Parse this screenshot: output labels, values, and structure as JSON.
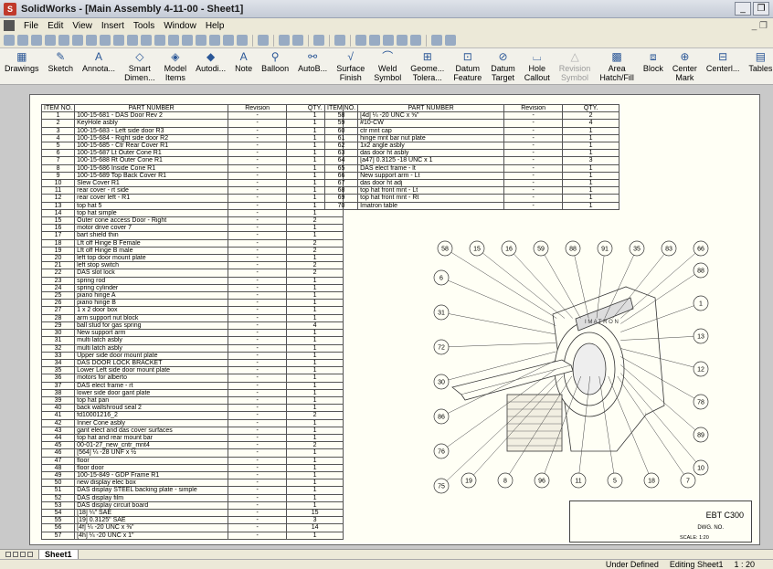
{
  "window": {
    "title": "SolidWorks - [Main Assembly 4-11-00 - Sheet1]"
  },
  "menu": [
    "File",
    "Edit",
    "View",
    "Insert",
    "Tools",
    "Window",
    "Help"
  ],
  "command_manager": [
    {
      "label": "Drawings",
      "icon": "drawings-icon",
      "glyph": "▦",
      "enabled": true
    },
    {
      "label": "Sketch",
      "icon": "sketch-icon",
      "glyph": "✎",
      "enabled": true
    },
    {
      "label": "Annota...",
      "icon": "annotation-icon",
      "glyph": "A",
      "enabled": true
    },
    {
      "label": "Smart Dimen...",
      "icon": "smart-dimension-icon",
      "glyph": "◇",
      "enabled": true
    },
    {
      "label": "Model Items",
      "icon": "model-items-icon",
      "glyph": "◈",
      "enabled": true
    },
    {
      "label": "Autodi...",
      "icon": "autodimension-icon",
      "glyph": "◆",
      "enabled": true
    },
    {
      "label": "Note",
      "icon": "note-icon",
      "glyph": "A",
      "enabled": true
    },
    {
      "label": "Balloon",
      "icon": "balloon-icon",
      "glyph": "⚲",
      "enabled": true
    },
    {
      "label": "AutoB...",
      "icon": "auto-balloon-icon",
      "glyph": "⚯",
      "enabled": true
    },
    {
      "label": "Surface Finish",
      "icon": "surface-finish-icon",
      "glyph": "√",
      "enabled": true
    },
    {
      "label": "Weld Symbol",
      "icon": "weld-symbol-icon",
      "glyph": "⌒",
      "enabled": true
    },
    {
      "label": "Geome... Tolera...",
      "icon": "geometric-tolerance-icon",
      "glyph": "⊞",
      "enabled": true
    },
    {
      "label": "Datum Feature",
      "icon": "datum-feature-icon",
      "glyph": "⊡",
      "enabled": true
    },
    {
      "label": "Datum Target",
      "icon": "datum-target-icon",
      "glyph": "⊘",
      "enabled": true
    },
    {
      "label": "Hole Callout",
      "icon": "hole-callout-icon",
      "glyph": "⌴",
      "enabled": true
    },
    {
      "label": "Revision Symbol",
      "icon": "revision-symbol-icon",
      "glyph": "△",
      "enabled": false
    },
    {
      "label": "Area Hatch/Fill",
      "icon": "area-hatch-icon",
      "glyph": "▩",
      "enabled": true
    },
    {
      "label": "Block",
      "icon": "block-icon",
      "glyph": "⧈",
      "enabled": true
    },
    {
      "label": "Center Mark",
      "icon": "center-mark-icon",
      "glyph": "⊕",
      "enabled": true
    },
    {
      "label": "Centerl...",
      "icon": "centerline-icon",
      "glyph": "⊟",
      "enabled": true
    },
    {
      "label": "Tables",
      "icon": "tables-icon",
      "glyph": "▤",
      "enabled": true
    }
  ],
  "bom_headers": [
    "ITEM NO.",
    "PART NUMBER",
    "Revision",
    "QTY."
  ],
  "bom_left": [
    [
      "1",
      "100-15-681 - DAS Door Rev 2",
      "-",
      "1"
    ],
    [
      "2",
      "KeyHole asbly",
      "-",
      "1"
    ],
    [
      "3",
      "100-15-683 - Left side door R3",
      "-",
      "1"
    ],
    [
      "4",
      "100-15-684 - Right side door R2",
      "-",
      "1"
    ],
    [
      "5",
      "100-15-685 - Ctr Rear Cover R1",
      "-",
      "1"
    ],
    [
      "6",
      "100-15-687 Lt Outer Cone R1",
      "-",
      "1"
    ],
    [
      "7",
      "100-15-688 Rt Outer Cone R1",
      "-",
      "1"
    ],
    [
      "8",
      "100-15-686 Inside Cone R1",
      "-",
      "1"
    ],
    [
      "9",
      "100-15-689 Top Back Cover R1",
      "-",
      "1"
    ],
    [
      "10",
      "Slew Cover R1",
      "-",
      "1"
    ],
    [
      "11",
      "rear cover - rt side",
      "-",
      "1"
    ],
    [
      "12",
      "rear cover left - R1",
      "-",
      "1"
    ],
    [
      "13",
      "top hat 5",
      "-",
      "1"
    ],
    [
      "14",
      "top hat simple",
      "-",
      "1"
    ],
    [
      "15",
      "Outer cone access Door - Right",
      "-",
      "2"
    ],
    [
      "16",
      "motor drive cover 7",
      "-",
      "1"
    ],
    [
      "17",
      "bart shield thin",
      "-",
      "1"
    ],
    [
      "18",
      "Lft off Hinge B Female",
      "-",
      "2"
    ],
    [
      "19",
      "Lft off Hinge B male",
      "-",
      "2"
    ],
    [
      "20",
      "left top door mount plate",
      "-",
      "1"
    ],
    [
      "21",
      "left stop switch",
      "-",
      "2"
    ],
    [
      "22",
      "DAS slot lock",
      "-",
      "2"
    ],
    [
      "23",
      "spring rod",
      "-",
      "1"
    ],
    [
      "24",
      "spring cylinder",
      "-",
      "1"
    ],
    [
      "25",
      "piano hinge A",
      "-",
      "1"
    ],
    [
      "26",
      "piano hinge B",
      "-",
      "1"
    ],
    [
      "27",
      "1 x 2 door box",
      "-",
      "1"
    ],
    [
      "28",
      "arm support nut block",
      "-",
      "1"
    ],
    [
      "29",
      "ball stud for gas spring",
      "-",
      "4"
    ],
    [
      "30",
      "New support arm",
      "-",
      "1"
    ],
    [
      "31",
      "multi latch asbly",
      "-",
      "1"
    ],
    [
      "32",
      "multi latch asbly",
      "-",
      "1"
    ],
    [
      "33",
      "Upper side door mount plate",
      "-",
      "1"
    ],
    [
      "34",
      "DAS DOOR LOCK BRACKET",
      "-",
      "1"
    ],
    [
      "35",
      "Lower Left side door mount plate",
      "-",
      "1"
    ],
    [
      "36",
      "motors for alberto",
      "-",
      "1"
    ],
    [
      "37",
      "DAS elect frame - rt",
      "-",
      "1"
    ],
    [
      "38",
      "lower side door gant plate",
      "-",
      "1"
    ],
    [
      "39",
      "top hat pan",
      "-",
      "1"
    ],
    [
      "40",
      "back wallshroud seal 2",
      "-",
      "1"
    ],
    [
      "41",
      "fd10001216_2",
      "-",
      "2"
    ],
    [
      "42",
      "Inner Cone asbly",
      "-",
      "1"
    ],
    [
      "43",
      "gant elect and das cover surfaces",
      "-",
      "1"
    ],
    [
      "44",
      "top hat and rear mount bar",
      "-",
      "1"
    ],
    [
      "45",
      "00-01-27_new_cntr_mnt4",
      "-",
      "2"
    ],
    [
      "46",
      "[564] ¼ -28 UNF x ½",
      "-",
      "1"
    ],
    [
      "47",
      "floor",
      "-",
      "1"
    ],
    [
      "48",
      "floor door",
      "-",
      "1"
    ],
    [
      "49",
      "100-15-849 - GDP Frame R1",
      "-",
      "1"
    ],
    [
      "50",
      "new display elec box",
      "-",
      "1"
    ],
    [
      "51",
      "DAS display STEEL backing plate - simple",
      "-",
      "1"
    ],
    [
      "52",
      "DAS display film",
      "-",
      "1"
    ],
    [
      "53",
      "DAS display circuit board",
      "-",
      "1"
    ],
    [
      "54",
      "[18]  ¼\" SAE",
      "-",
      "15"
    ],
    [
      "55",
      "[19]  0.3125\" SAE",
      "-",
      "3"
    ],
    [
      "56",
      "[4f]  ¼ -20 UNC x ⅜\"",
      "-",
      "14"
    ],
    [
      "57",
      "[4h]  ¼ -20 UNC x 1\"",
      "-",
      "1"
    ]
  ],
  "bom_right": [
    [
      "58",
      "[4d]  ¼ -20 UNC x ⅝\"",
      "-",
      "2"
    ],
    [
      "59",
      "#10-CW",
      "-",
      "4"
    ],
    [
      "60",
      "ctr mnt cap",
      "-",
      "1"
    ],
    [
      "61",
      "hinge mnt bar nut plate",
      "-",
      "1"
    ],
    [
      "62",
      "1x2 angle asbly",
      "-",
      "1"
    ],
    [
      "63",
      "das door ht asbly",
      "-",
      "1"
    ],
    [
      "64",
      "[a47]  0.3125 -18 UNC x 1",
      "-",
      "3"
    ],
    [
      "65",
      "DAS elect frame - lt",
      "-",
      "1"
    ],
    [
      "66",
      "New support arm - Lt",
      "-",
      "1"
    ],
    [
      "67",
      "das door ht adj",
      "-",
      "1"
    ],
    [
      "68",
      "top hat front mnt - Lt",
      "-",
      "1"
    ],
    [
      "69",
      "top hat front mnt - Rt",
      "-",
      "1"
    ],
    [
      "70",
      "Imatron table",
      "-",
      "1"
    ]
  ],
  "balloons_top": [
    "58",
    "15",
    "16",
    "59",
    "88",
    "91",
    "35",
    "83",
    "66"
  ],
  "balloons_left": [
    "6",
    "31",
    "72",
    "30",
    "86",
    "76",
    "75"
  ],
  "balloons_right": [
    "88",
    "1",
    "13",
    "12",
    "78",
    "89",
    "10"
  ],
  "balloons_bottom": [
    "19",
    "8",
    "96",
    "11",
    "5",
    "18",
    "7"
  ],
  "title_block": {
    "title": "EBT C300",
    "dwg_no": "DWG. NO.",
    "scale": "SCALE: 1:20"
  },
  "sheet_tab": "Sheet1",
  "status": {
    "state": "Under Defined",
    "editing": "Editing Sheet1",
    "scale": "1 : 20"
  }
}
